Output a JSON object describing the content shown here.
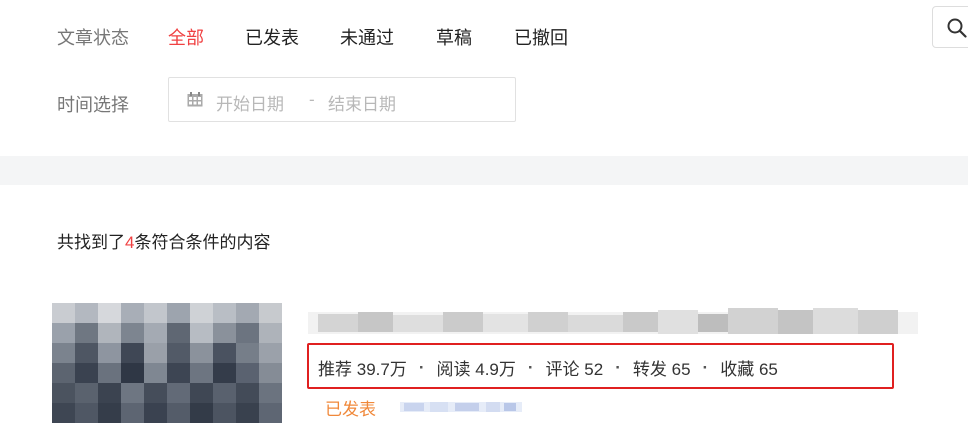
{
  "filters": {
    "status_label": "文章状态",
    "status_tabs": [
      {
        "label": "全部",
        "active": true
      },
      {
        "label": "已发表",
        "active": false
      },
      {
        "label": "未通过",
        "active": false
      },
      {
        "label": "草稿",
        "active": false
      },
      {
        "label": "已撤回",
        "active": false
      }
    ],
    "time_label": "时间选择",
    "date_range": {
      "start_placeholder": "开始日期",
      "separator": "-",
      "end_placeholder": "结束日期"
    },
    "search_icon": "search-icon"
  },
  "results": {
    "summary_prefix": "共找到了",
    "count": "4",
    "summary_suffix": "条符合条件的内容"
  },
  "article": {
    "stats": [
      {
        "label": "推荐",
        "value": "39.7万"
      },
      {
        "label": "阅读",
        "value": "4.9万"
      },
      {
        "label": "评论",
        "value": "52"
      },
      {
        "label": "转发",
        "value": "65"
      },
      {
        "label": "收藏",
        "value": "65"
      }
    ],
    "stat_separator": "·",
    "status": "已发表"
  },
  "colors": {
    "accent_red": "#f04142",
    "highlight_box": "#e02020",
    "published_orange": "#f0883a"
  }
}
